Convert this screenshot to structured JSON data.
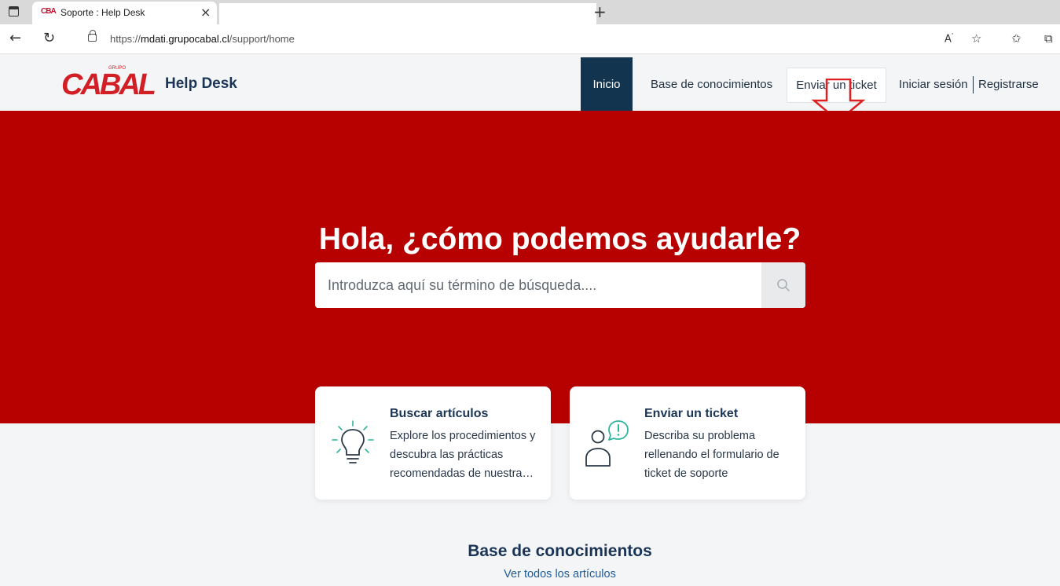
{
  "browser": {
    "tab_title": "Soporte : Help Desk",
    "tab_favicon": "CBA",
    "url_prefix": "https://",
    "url_domain": "mdati.grupocabal.cl",
    "url_path": "/support/home"
  },
  "header": {
    "logo_text": "CABAL",
    "logo_small": "GRUPO",
    "brand_title": "Help Desk",
    "nav": {
      "inicio": "Inicio",
      "base": "Base de conocimientos",
      "ticket": "Enviar un ticket",
      "login": "Iniciar sesión",
      "register": "Registrarse"
    }
  },
  "hero": {
    "title": "Hola, ¿cómo podemos ayudarle?",
    "search_placeholder": "Introduzca aquí su término de búsqueda...."
  },
  "cards": [
    {
      "title": "Buscar artículos",
      "description": "Explore los procedimientos y descubra las prácticas recomendadas de nuestra…",
      "icon": "lightbulb-icon"
    },
    {
      "title": "Enviar un ticket",
      "description": "Describa su problema rellenando el formulario de ticket de soporte",
      "icon": "user-alert-icon"
    }
  ],
  "knowledge_base": {
    "title": "Base de conocimientos",
    "link": "Ver todos los artículos"
  },
  "colors": {
    "brand_red": "#b70000",
    "nav_active": "#12344e",
    "heading": "#1a3555",
    "accent_green": "#2fb59a"
  }
}
